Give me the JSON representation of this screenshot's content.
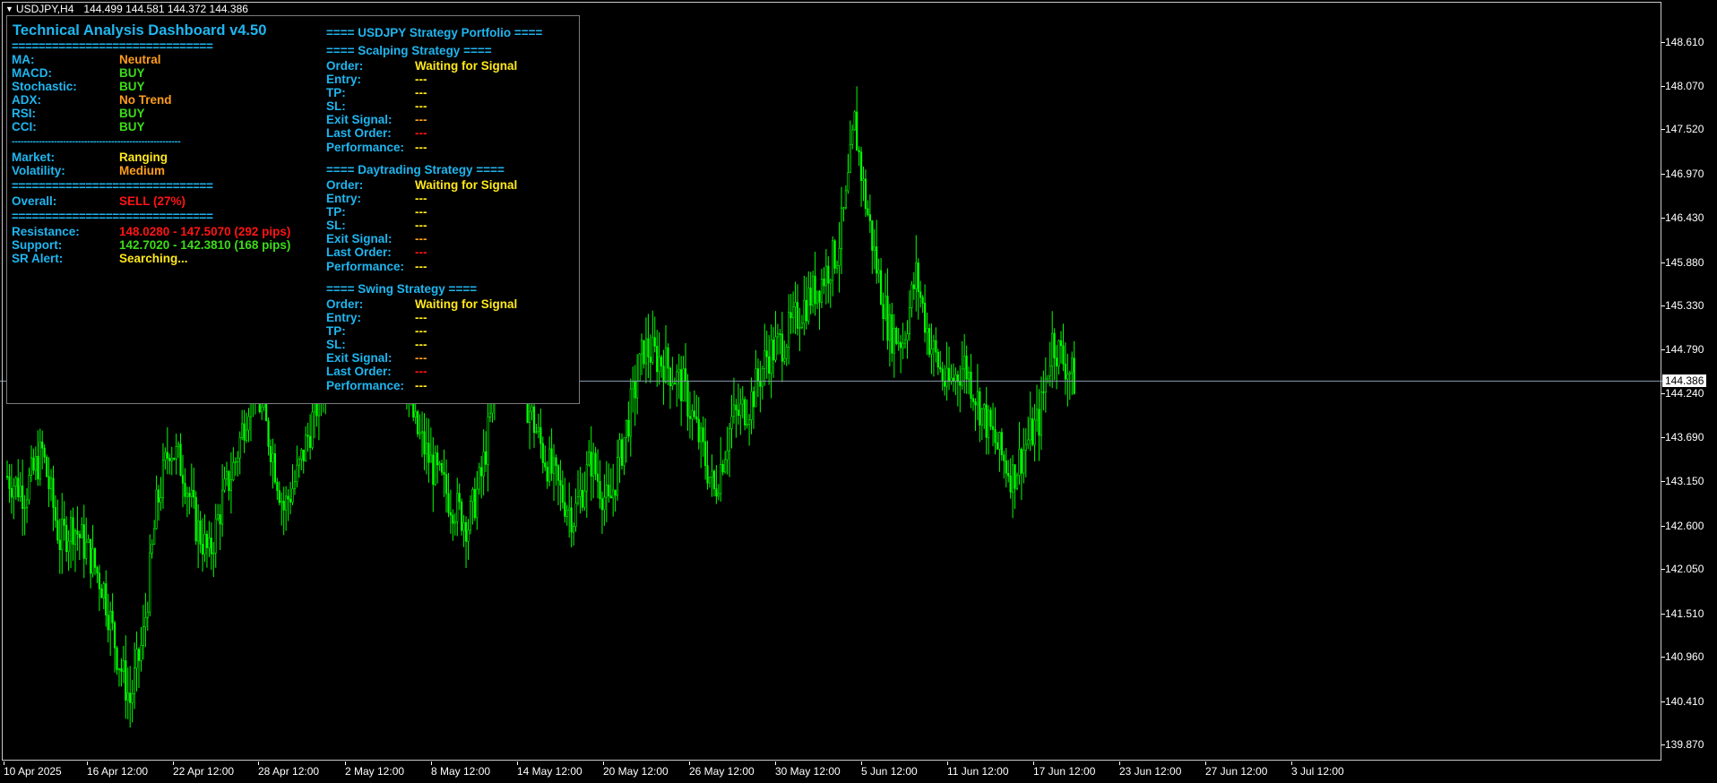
{
  "header": {
    "symbol": "USDJPY,H4",
    "prices": "144.499 144.581 144.372 144.386"
  },
  "price_axis": {
    "ticks": [
      "148.610",
      "148.070",
      "147.520",
      "146.970",
      "146.430",
      "145.880",
      "145.330",
      "144.790",
      "144.240",
      "143.690",
      "143.150",
      "142.600",
      "142.050",
      "141.510",
      "140.960",
      "140.410",
      "139.870"
    ],
    "current_price": "144.386"
  },
  "time_axis": {
    "ticks": [
      "10 Apr 2025",
      "16 Apr 12:00",
      "22 Apr 12:00",
      "28 Apr 12:00",
      "2 May 12:00",
      "8 May 12:00",
      "14 May 12:00",
      "20 May 12:00",
      "26 May 12:00",
      "30 May 12:00",
      "5 Jun 12:00",
      "11 Jun 12:00",
      "17 Jun 12:00",
      "23 Jun 12:00",
      "27 Jun 12:00",
      "3 Jul 12:00"
    ]
  },
  "colors": {
    "candle": "#00ff00",
    "background": "#000000",
    "label": "#1fb6f0",
    "buy": "#3cdc18",
    "neutral": "#ff9d1c",
    "sell": "#ff1414",
    "wait": "#ffe81a"
  },
  "dashboard": {
    "title": "Technical Analysis Dashboard v4.50",
    "separator_eq": "==============================",
    "separator_dash": "--------------------------------------------------------",
    "indicators": [
      {
        "label": "MA:",
        "value": "Neutral"
      },
      {
        "label": "MACD:",
        "value": "BUY"
      },
      {
        "label": "Stochastic:",
        "value": "BUY"
      },
      {
        "label": "ADX:",
        "value": "No Trend"
      },
      {
        "label": "RSI:",
        "value": "BUY"
      },
      {
        "label": "CCI:",
        "value": "BUY"
      }
    ],
    "market": {
      "label": "Market:",
      "value": "Ranging"
    },
    "volatility": {
      "label": "Volatility:",
      "value": "Medium"
    },
    "overall": {
      "label": "Overall:",
      "value": "SELL (27%)"
    },
    "resistance": {
      "label": "Resistance:",
      "value": "148.0280 - 147.5070 (292 pips)"
    },
    "support": {
      "label": "Support:",
      "value": "142.7020 - 142.3810 (168 pips)"
    },
    "sr_alert": {
      "label": "SR Alert:",
      "value": "Searching..."
    }
  },
  "portfolio": {
    "title": "==== USDJPY Strategy Portfolio ====",
    "strategies": [
      {
        "title": "==== Scalping Strategy ====",
        "rows": [
          {
            "label": "Order:",
            "value": "Waiting for Signal"
          },
          {
            "label": "Entry:",
            "value": "---"
          },
          {
            "label": "TP:",
            "value": "---"
          },
          {
            "label": "SL:",
            "value": "---"
          },
          {
            "label": "Exit Signal:",
            "value": "---"
          },
          {
            "label": "Last Order:",
            "value": "---"
          },
          {
            "label": "Performance:",
            "value": "---"
          }
        ]
      },
      {
        "title": "==== Daytrading Strategy ====",
        "rows": [
          {
            "label": "Order:",
            "value": "Waiting for Signal"
          },
          {
            "label": "Entry:",
            "value": "---"
          },
          {
            "label": "TP:",
            "value": "---"
          },
          {
            "label": "SL:",
            "value": "---"
          },
          {
            "label": "Exit Signal:",
            "value": "---"
          },
          {
            "label": "Last Order:",
            "value": "---"
          },
          {
            "label": "Performance:",
            "value": "---"
          }
        ]
      },
      {
        "title": "==== Swing Strategy ====",
        "rows": [
          {
            "label": "Order:",
            "value": "Waiting for Signal"
          },
          {
            "label": "Entry:",
            "value": "---"
          },
          {
            "label": "TP:",
            "value": "---"
          },
          {
            "label": "SL:",
            "value": "---"
          },
          {
            "label": "Exit Signal:",
            "value": "---"
          },
          {
            "label": "Last Order:",
            "value": "---"
          },
          {
            "label": "Performance:",
            "value": "---"
          }
        ]
      }
    ]
  }
}
